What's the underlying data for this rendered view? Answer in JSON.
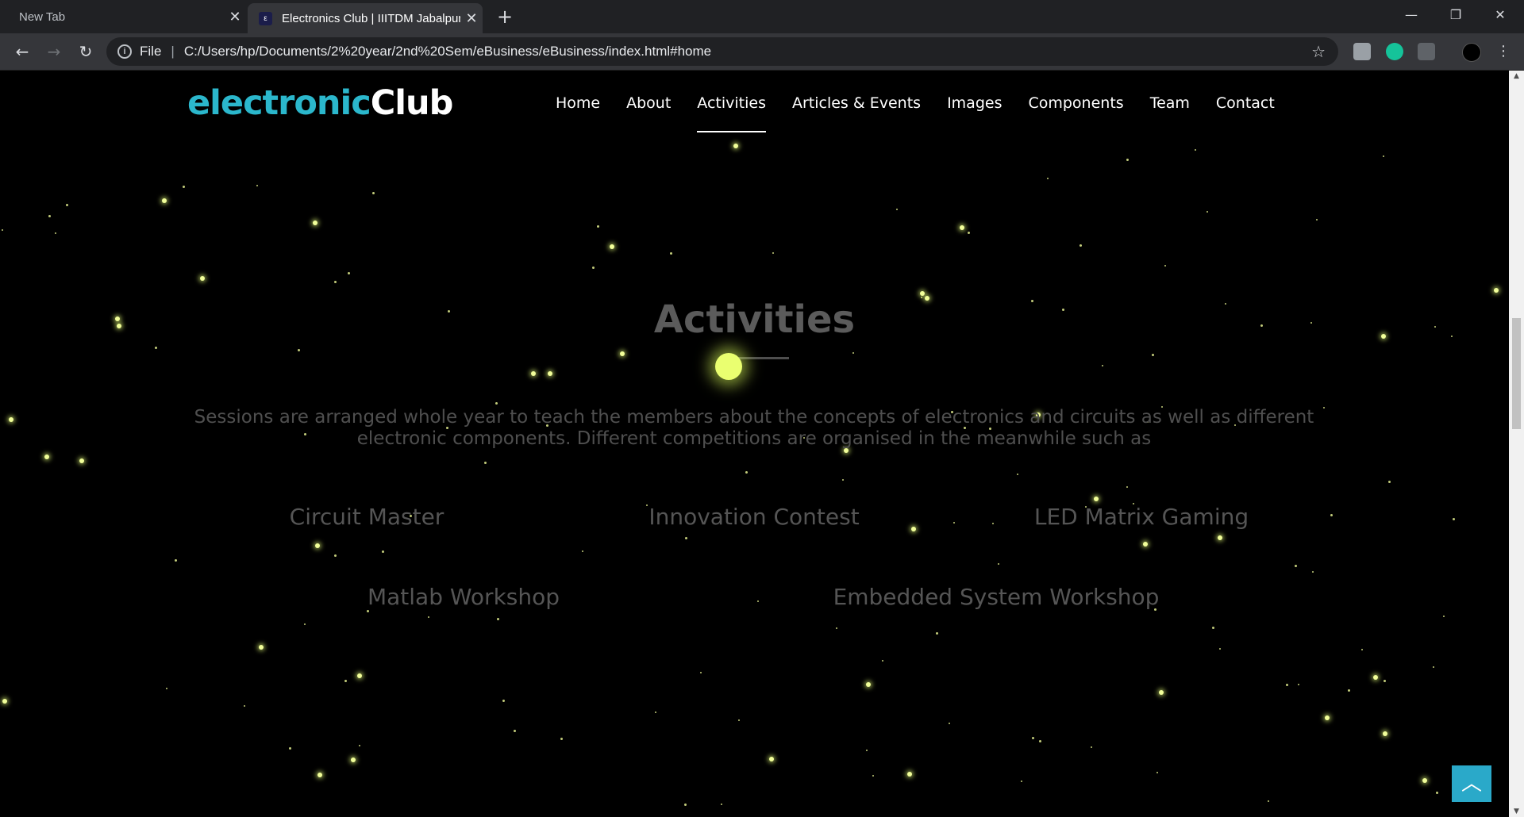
{
  "browser": {
    "tabs": [
      {
        "title": "New Tab"
      },
      {
        "title": "Electronics Club | IIITDM Jabalpur",
        "favicon": "electronic-club-favicon"
      }
    ],
    "address": {
      "scheme_label": "File",
      "url": "C:/Users/hp/Documents/2%20year/2nd%20Sem/eBusiness/eBusiness/index.html#home"
    }
  },
  "site": {
    "logo": {
      "part1": "electronic",
      "part2": "Club",
      "color1": "#2bb7cc",
      "color2": "#ffffff"
    },
    "menu": [
      "Home",
      "About",
      "Activities",
      "Articles & Events",
      "Images",
      "Components",
      "Team",
      "Contact"
    ],
    "active_menu": "Activities"
  },
  "section": {
    "title": "Activities",
    "description": "Sessions are arranged whole year to teach the members about the concepts of electronics and circuits as well as different electronic components. Different competitions are organised in the meanwhile such as",
    "items": [
      "Circuit Master",
      "Innovation Contest",
      "LED Matrix Gaming",
      "Matlab Workshop",
      "Embedded System Workshop"
    ]
  },
  "colors": {
    "accent": "#2aa9c9",
    "background": "#000000",
    "star": "#f2ff9a"
  }
}
